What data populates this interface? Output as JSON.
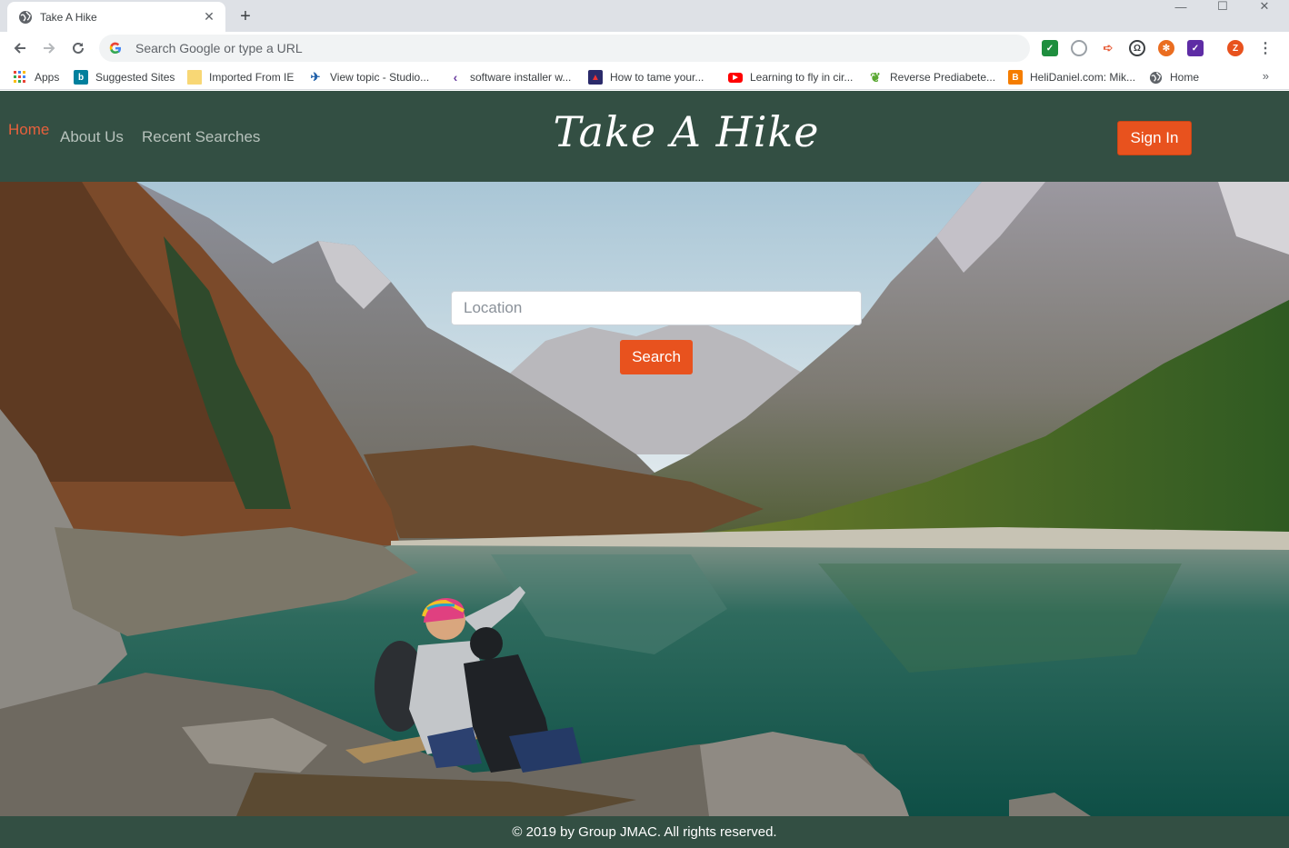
{
  "browser": {
    "tab_title": "Take A Hike",
    "tab_close": "✕",
    "new_tab": "+",
    "omnibox_placeholder": "Search Google or type a URL",
    "window_controls": {
      "minimize": "—",
      "maximize": "☐",
      "close": "✕"
    },
    "bookmarks": [
      {
        "label": "Apps",
        "icon": "apps-grid-icon"
      },
      {
        "label": "Suggested Sites",
        "icon": "bing-icon"
      },
      {
        "label": "Imported From IE",
        "icon": "folder-icon"
      },
      {
        "label": "View topic - Studio...",
        "icon": "bird-icon"
      },
      {
        "label": "software installer w...",
        "icon": "visual-studio-icon"
      },
      {
        "label": "How to tame your...",
        "icon": "dragon-icon"
      },
      {
        "label": "Learning to fly in cir...",
        "icon": "youtube-icon"
      },
      {
        "label": "Reverse Prediabete...",
        "icon": "leaf-icon"
      },
      {
        "label": "HeliDaniel.com: Mik...",
        "icon": "blogger-icon"
      },
      {
        "label": "Home",
        "icon": "globe-icon"
      }
    ],
    "bookmarks_more": "»",
    "profile_initial": "Z"
  },
  "site": {
    "nav": {
      "home": "Home",
      "about": "About Us",
      "recent": "Recent Searches"
    },
    "title": "Take A Hike",
    "sign_in": "Sign In",
    "search": {
      "placeholder": "Location",
      "button": "Search"
    },
    "footer": "© 2019 by Group JMAC. All rights reserved."
  },
  "colors": {
    "header_bg": "#334f43",
    "accent": "#e8521e",
    "nav_active": "#e8603c",
    "nav_inactive": "#b7c2bc"
  }
}
